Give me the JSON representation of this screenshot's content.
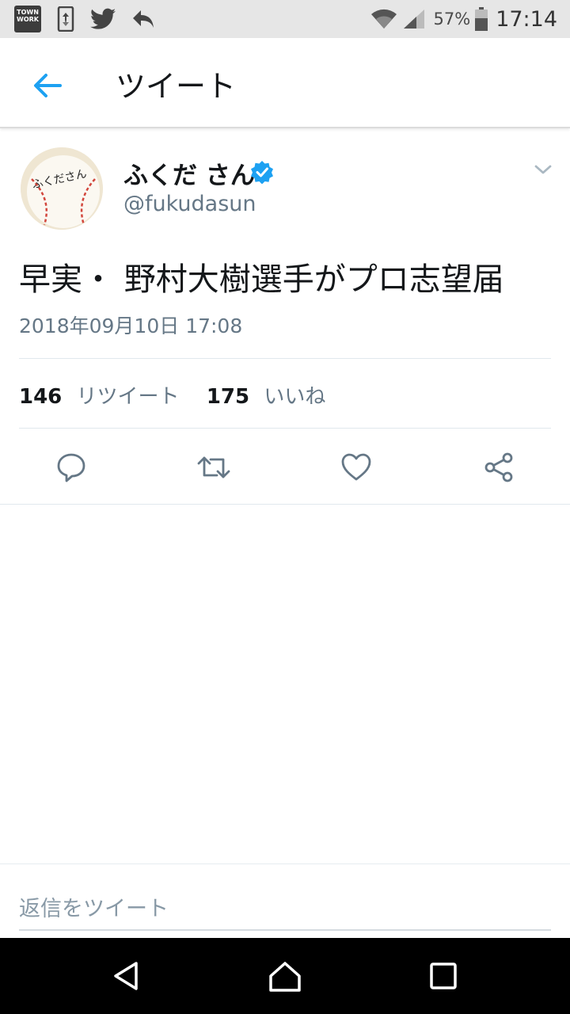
{
  "status_bar": {
    "townwork_label": "TOWN WORK",
    "battery": "57%",
    "time": "17:14",
    "icons": [
      "townwork-app-icon",
      "sync-icon",
      "twitter-icon",
      "reply-notification-icon",
      "wifi-icon",
      "signal-icon",
      "battery-icon"
    ]
  },
  "app_bar": {
    "title": "ツイート",
    "back_icon": "arrow-left-icon"
  },
  "tweet": {
    "display_name": "ふくだ さん",
    "handle": "@fukudasun",
    "verified": true,
    "avatar_text": "ふくださん",
    "text": "早実・ 野村大樹選手がプロ志望届",
    "timestamp": "2018年09月10日 17:08",
    "retweet_count": "146",
    "retweet_label": "リツイート",
    "like_count": "175",
    "like_label": "いいね",
    "actions": [
      "reply-icon",
      "retweet-icon",
      "like-icon",
      "share-icon"
    ]
  },
  "reply_box": {
    "placeholder": "返信をツイート"
  },
  "nav_bar": {
    "buttons": [
      "back-triangle-icon",
      "home-icon",
      "recents-icon"
    ]
  },
  "colors": {
    "accent": "#1da1f2",
    "secondary_text": "#657786",
    "primary_text": "#14171a"
  }
}
